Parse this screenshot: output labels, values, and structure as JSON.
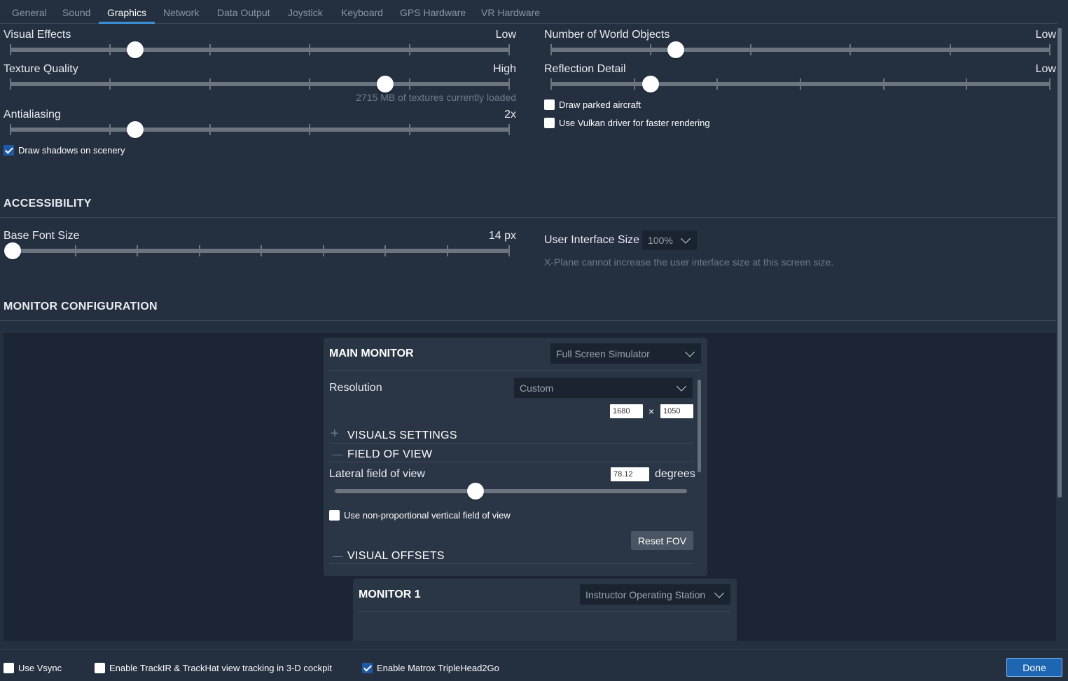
{
  "tabs": [
    "General",
    "Sound",
    "Graphics",
    "Network",
    "Data Output",
    "Joystick",
    "Keyboard",
    "GPS Hardware",
    "VR Hardware"
  ],
  "active_tab": "Graphics",
  "graphics": {
    "visual_effects": {
      "label": "Visual Effects",
      "value": "Low",
      "level": 0.25
    },
    "texture_quality": {
      "label": "Texture Quality",
      "value": "High",
      "level": 0.75,
      "note": "2715 MB of textures currently loaded"
    },
    "antialiasing": {
      "label": "Antialiasing",
      "value": "2x",
      "level": 0.25
    },
    "draw_shadows": {
      "label": "Draw shadows on scenery",
      "checked": true
    },
    "world_objects": {
      "label": "Number of World Objects",
      "value": "Low",
      "level": 0.25
    },
    "reflection_detail": {
      "label": "Reflection Detail",
      "value": "Low",
      "level": 0.2
    },
    "draw_parked_aircraft": {
      "label": "Draw parked aircraft",
      "checked": false
    },
    "vulkan": {
      "label": "Use Vulkan driver for faster rendering",
      "checked": false
    }
  },
  "accessibility": {
    "title": "ACCESSIBILITY",
    "base_font_size": {
      "label": "Base Font Size",
      "value": "14 px",
      "level": 0.0
    },
    "ui_size": {
      "label": "User Interface Size",
      "value": "100%",
      "note": "X-Plane cannot increase the user interface size at this screen size."
    }
  },
  "monitor_config": {
    "title": "MONITOR CONFIGURATION",
    "main_monitor": {
      "title": "MAIN MONITOR",
      "mode": "Full Screen Simulator",
      "resolution_label": "Resolution",
      "resolution_mode": "Custom",
      "width": "1680",
      "height": "1050",
      "times": "×",
      "visuals_settings": "VISUALS SETTINGS",
      "field_of_view": "FIELD OF VIEW",
      "lateral_fov_label": "Lateral field of view",
      "lateral_fov_value": "78.12",
      "degrees": "degrees",
      "fov_level": 0.4,
      "non_proportional": {
        "label": "Use non-proportional vertical field of view",
        "checked": false
      },
      "reset_fov": "Reset FOV",
      "visual_offsets": "VISUAL OFFSETS",
      "plus_symbol": "+",
      "minus_symbol": "—"
    },
    "monitor1": {
      "title": "MONITOR 1",
      "mode": "Instructor Operating Station"
    }
  },
  "footer": {
    "vsync": {
      "label": "Use Vsync",
      "checked": false
    },
    "trackir": {
      "label": "Enable TrackIR & TrackHat view tracking in 3-D cockpit",
      "checked": false
    },
    "matrox": {
      "label": "Enable Matrox TripleHead2Go",
      "checked": true
    },
    "done": "Done"
  },
  "colors": {
    "background": "#243040",
    "accent": "#3b8fd6",
    "done_button": "#1f66b2"
  }
}
